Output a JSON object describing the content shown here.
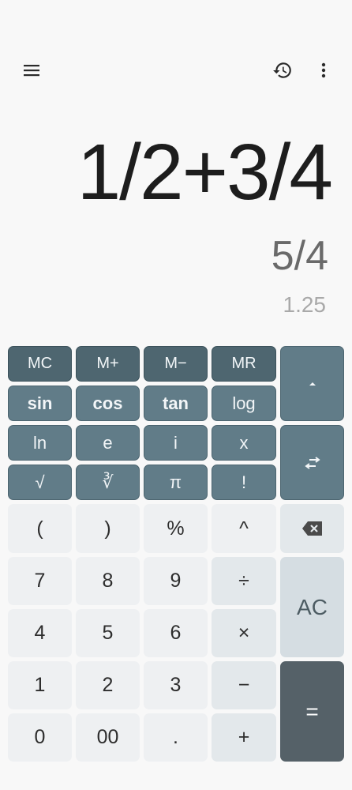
{
  "topbar": {
    "menu_icon": "hamburger-menu-icon",
    "history_icon": "history-icon",
    "more_icon": "more-vert-icon"
  },
  "display": {
    "expression": "1/2+3/4",
    "result": "5/4",
    "decimal": "1.25"
  },
  "keys": {
    "mc": "MC",
    "mplus": "M+",
    "mminus": "M−",
    "mr": "MR",
    "sin": "sin",
    "cos": "cos",
    "tan": "tan",
    "log": "log",
    "ln": "ln",
    "e": "e",
    "i": "i",
    "x": "x",
    "sqrt": "√",
    "cbrt": "∛",
    "pi": "π",
    "fact": "!",
    "lparen": "(",
    "rparen": ")",
    "percent": "%",
    "pow": "^",
    "seven": "7",
    "eight": "8",
    "nine": "9",
    "divide": "÷",
    "four": "4",
    "five": "5",
    "six": "6",
    "multiply": "×",
    "one": "1",
    "two": "2",
    "three": "3",
    "minus": "−",
    "zero": "0",
    "double_zero": "00",
    "dot": ".",
    "plus": "+",
    "ac": "AC",
    "equals": "="
  },
  "side_icons": {
    "collapse": "caret-up-icon",
    "swap": "swap-arrows-icon",
    "backspace": "backspace-icon"
  },
  "colors": {
    "memory_key": "#4e6670",
    "function_key": "#617c88",
    "equals_key": "#556168",
    "ac_key": "#d5dde2",
    "background": "#f8f8f8"
  }
}
